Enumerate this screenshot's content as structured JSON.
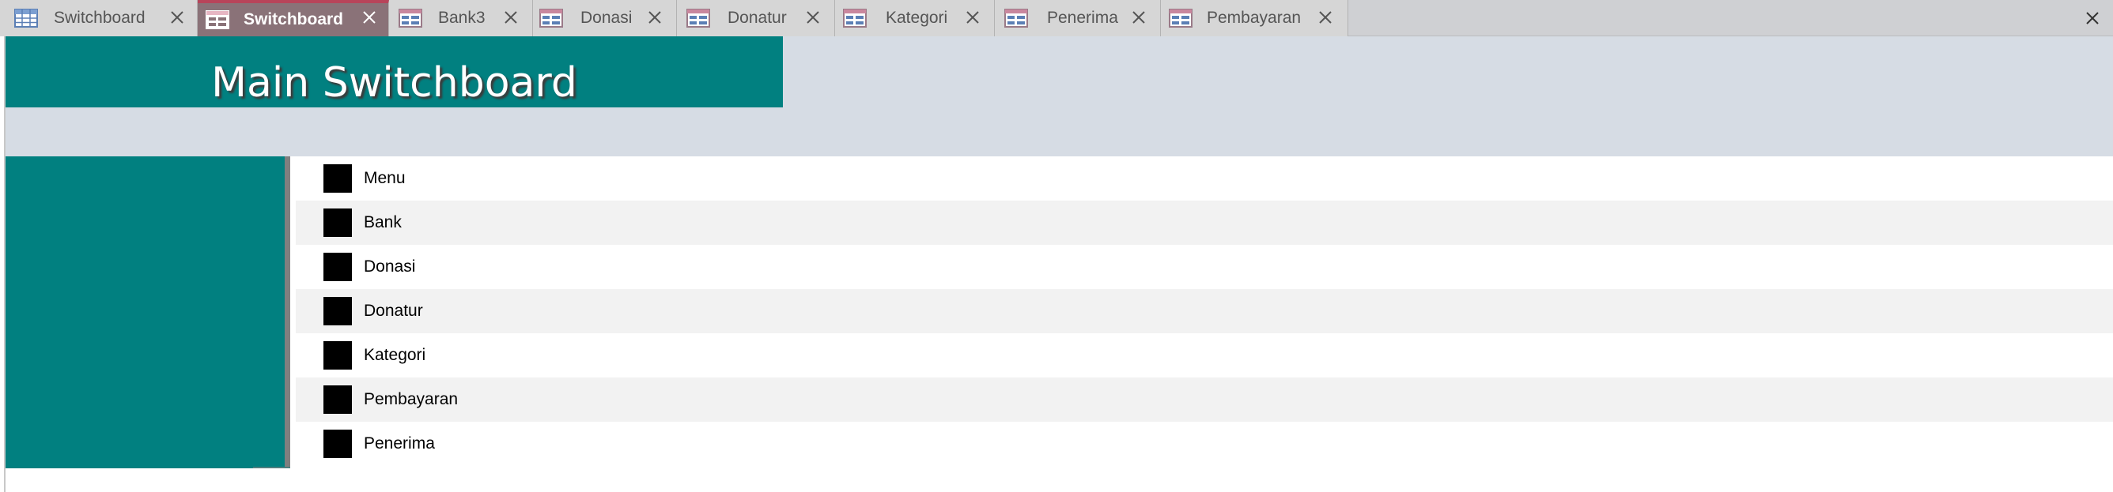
{
  "tabs": [
    {
      "label": "Switchboard",
      "icon": "table-icon",
      "active": false
    },
    {
      "label": "Switchboard",
      "icon": "form-icon",
      "active": true
    },
    {
      "label": "Bank3",
      "icon": "form-icon",
      "active": false
    },
    {
      "label": "Donasi",
      "icon": "form-icon",
      "active": false
    },
    {
      "label": "Donatur",
      "icon": "form-icon",
      "active": false
    },
    {
      "label": "Kategori",
      "icon": "form-icon",
      "active": false
    },
    {
      "label": "Penerima",
      "icon": "form-icon",
      "active": false
    },
    {
      "label": "Pembayaran",
      "icon": "form-icon",
      "active": false
    }
  ],
  "form": {
    "title": "Main Switchboard",
    "items": [
      {
        "label": "Menu"
      },
      {
        "label": "Bank"
      },
      {
        "label": "Donasi"
      },
      {
        "label": "Donatur"
      },
      {
        "label": "Kategori"
      },
      {
        "label": "Pembayaran"
      },
      {
        "label": "Penerima"
      }
    ]
  },
  "colors": {
    "accent_teal": "#018080",
    "header_bg": "#d6dce4",
    "active_tab": "#8a7278",
    "active_tab_border": "#b8445a"
  }
}
